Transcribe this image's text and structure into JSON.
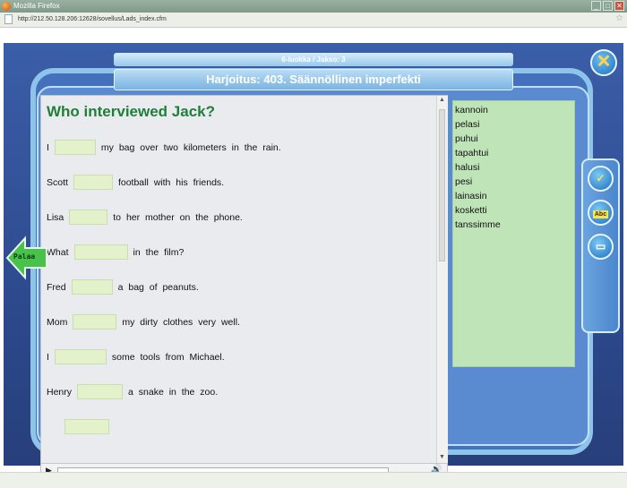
{
  "browser": {
    "title": "Mozilla Firefox",
    "url": "http://212.50.128.206:12628/sovellus/Lads_index.cfm",
    "window_buttons": [
      "_",
      "□",
      "✕"
    ]
  },
  "header": {
    "subtitle": "6-luokka / Jakso: 3",
    "title": "Harjoitus: 403. Säännöllinen imperfekti"
  },
  "exercise": {
    "question": "Who interviewed Jack?",
    "sentences": [
      {
        "before": "I",
        "after": "my bag over two kilometers in the rain."
      },
      {
        "before": "Scott",
        "after": "football with his friends."
      },
      {
        "before": "Lisa",
        "after": "to her mother on the phone."
      },
      {
        "before": "What",
        "after": "in the film?"
      },
      {
        "before": "Fred",
        "after": "a bag of peanuts."
      },
      {
        "before": "Mom",
        "after": "my dirty clothes very well."
      },
      {
        "before": "I",
        "after": "some tools from Michael."
      },
      {
        "before": "Henry",
        "after": "a snake in the zoo."
      }
    ]
  },
  "wordbank": {
    "words": [
      "kannoin",
      "pelasi",
      "puhui",
      "tapahtui",
      "halusi",
      "pesi",
      "lainasin",
      "kosketti",
      "tanssimme"
    ]
  },
  "navigation": {
    "back_label": "Palaa"
  },
  "tools": [
    {
      "icon": "check-pen-icon",
      "glyph": "✓"
    },
    {
      "icon": "abc-book-icon",
      "glyph": "Abc"
    },
    {
      "icon": "open-book-icon",
      "glyph": "▭"
    }
  ],
  "colors": {
    "question": "#1f7f3a",
    "blank_fill": "#e4f2cc",
    "wordbank_bg": "#bfe4b8",
    "stage_bg": "#2d4a8e",
    "back_arrow": "#48c24a"
  }
}
